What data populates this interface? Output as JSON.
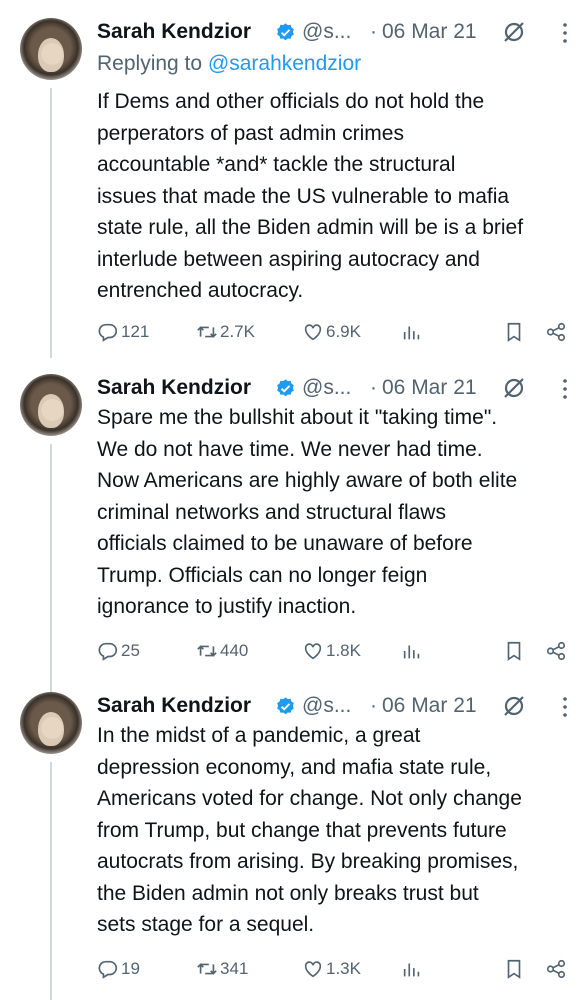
{
  "tweets": [
    {
      "name": "Sarah Kendzior",
      "handle": "@s...",
      "dot": "·",
      "date": "06 Mar 21",
      "reply_prefix": "Replying to ",
      "reply_handle": "@sarahkendzior",
      "text": "If Dems and other officials do not hold the\nperperators of past admin crimes\naccountable *and* tackle the structural\nissues that made the US vulnerable to mafia\nstate rule, all the Biden admin will be is a brief\ninterlude between aspiring autocracy and\nentrenched autocracy.",
      "replies": "121",
      "retweets": "2.7K",
      "likes": "6.9K"
    },
    {
      "name": "Sarah Kendzior",
      "handle": "@s...",
      "dot": "·",
      "date": "06 Mar 21",
      "text": "Spare me the bullshit about it \"taking time\".\nWe do not have time. We never had time.\nNow Americans are highly aware of both elite\ncriminal networks and structural flaws\nofficials claimed to be unaware of before\nTrump. Officials can no longer feign\nignorance to justify inaction.",
      "replies": "25",
      "retweets": "440",
      "likes": "1.8K"
    },
    {
      "name": "Sarah Kendzior",
      "handle": "@s...",
      "dot": "·",
      "date": "06 Mar 21",
      "text": "In the midst of a pandemic, a great\ndepression economy, and mafia state rule,\nAmericans voted for change. Not only change\nfrom Trump, but change that prevents future\nautocrats from arising. By breaking promises,\nthe Biden admin not only breaks trust but\nsets stage for a sequel.",
      "replies": "19",
      "retweets": "341",
      "likes": "1.3K"
    }
  ],
  "colors": {
    "text": "#0f1419",
    "secondary": "#536471",
    "link": "#1d9bf0",
    "verified": "#1d9bf0"
  },
  "icons": [
    "reply-icon",
    "retweet-icon",
    "like-icon",
    "views-icon",
    "bookmark-icon",
    "share-icon",
    "verified-badge-icon",
    "grok-icon",
    "more-icon"
  ]
}
